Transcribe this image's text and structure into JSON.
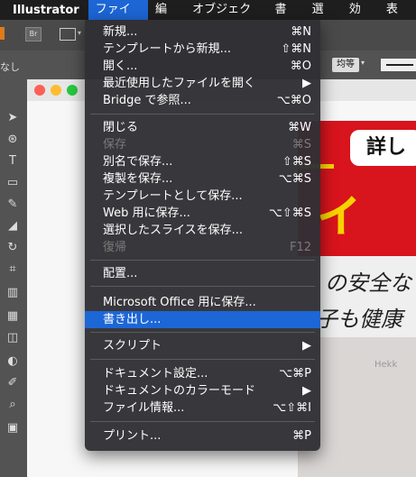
{
  "menubar": {
    "app_name": "Illustrator",
    "items": [
      "ファイル",
      "編集",
      "オブジェクト",
      "書式",
      "選択",
      "効果",
      "表示"
    ]
  },
  "control_bar": {
    "fill_label": "なし",
    "br_label": "Br",
    "stroke_align": "均等"
  },
  "file_menu": {
    "items": [
      {
        "label": "新規...",
        "shortcut": "⌘N",
        "enabled": true
      },
      {
        "label": "テンプレートから新規...",
        "shortcut": "⇧⌘N",
        "enabled": true
      },
      {
        "label": "開く...",
        "shortcut": "⌘O",
        "enabled": true
      },
      {
        "label": "最近使用したファイルを開く",
        "shortcut": "▶",
        "enabled": true
      },
      {
        "label": "Bridge で参照...",
        "shortcut": "⌥⌘O",
        "enabled": true
      },
      {
        "label": "閉じる",
        "shortcut": "⌘W",
        "enabled": true
      },
      {
        "label": "保存",
        "shortcut": "⌘S",
        "enabled": false
      },
      {
        "label": "別名で保存...",
        "shortcut": "⇧⌘S",
        "enabled": true
      },
      {
        "label": "複製を保存...",
        "shortcut": "⌥⌘S",
        "enabled": true
      },
      {
        "label": "テンプレートとして保存...",
        "shortcut": "",
        "enabled": true
      },
      {
        "label": "Web 用に保存...",
        "shortcut": "⌥⇧⌘S",
        "enabled": true
      },
      {
        "label": "選択したスライスを保存...",
        "shortcut": "",
        "enabled": true
      },
      {
        "label": "復帰",
        "shortcut": "F12",
        "enabled": false
      },
      {
        "label": "配置...",
        "shortcut": "",
        "enabled": true
      },
      {
        "label": "Microsoft Office 用に保存...",
        "shortcut": "",
        "enabled": true
      },
      {
        "label": "書き出し...",
        "shortcut": "",
        "enabled": true,
        "highlighted": true
      },
      {
        "label": "スクリプト",
        "shortcut": "▶",
        "enabled": true
      },
      {
        "label": "ドキュメント設定...",
        "shortcut": "⌥⌘P",
        "enabled": true
      },
      {
        "label": "ドキュメントのカラーモード",
        "shortcut": "▶",
        "enabled": true
      },
      {
        "label": "ファイル情報...",
        "shortcut": "⌥⇧⌘I",
        "enabled": true
      },
      {
        "label": "プリント...",
        "shortcut": "⌘P",
        "enabled": true
      }
    ]
  },
  "artwork": {
    "pill_text": "詳し",
    "big_text": "ィー",
    "line1": "の安全な",
    "line2": "子も健康も",
    "photo_text": "Hekk"
  },
  "colors": {
    "menubar_bg": "#1e1e1e",
    "highlight": "#1c66d6",
    "panel_bg": "#535353",
    "art_red": "#d8141c",
    "art_yellow": "#f6d300"
  }
}
